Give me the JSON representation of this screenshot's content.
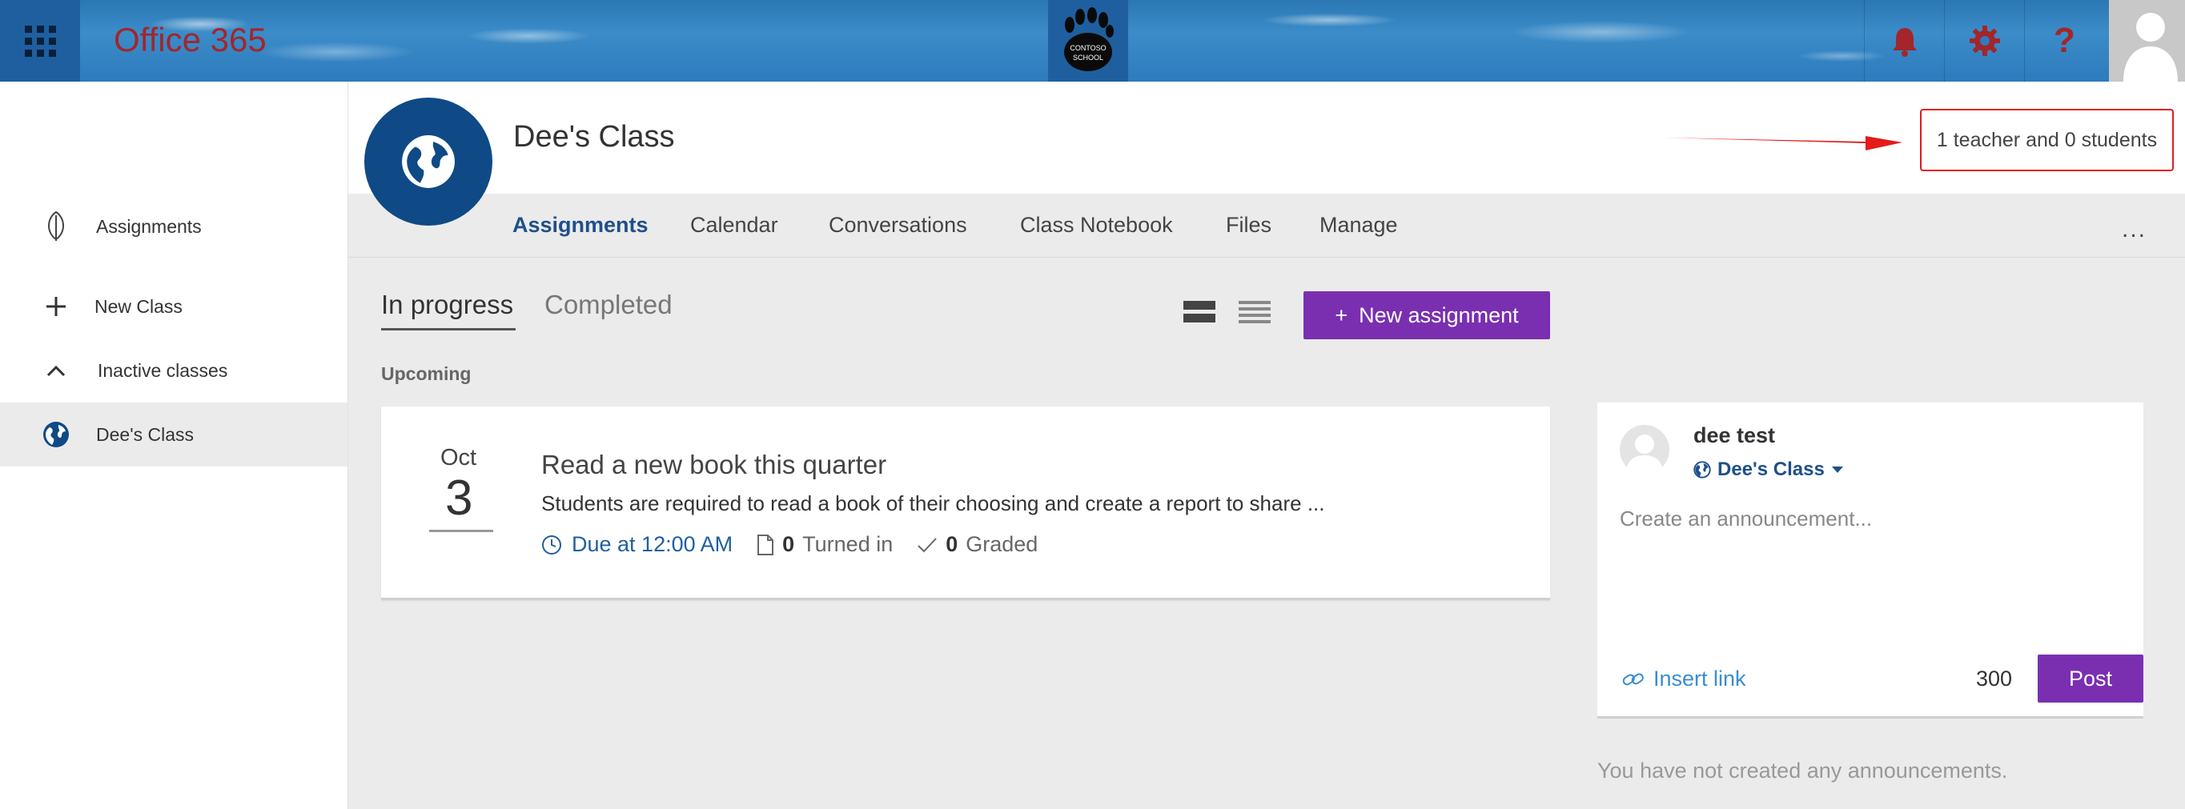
{
  "topbar": {
    "brand": "Office 365",
    "logo_text_line1": "CONTOSO",
    "logo_text_line2": "SCHOOL",
    "help_glyph": "?",
    "accent_color": "#a2262a",
    "bar_color": "#2d7bbd"
  },
  "sidebar": {
    "items": [
      {
        "label": "Assignments",
        "icon": "leaf-icon"
      },
      {
        "label": "New Class",
        "icon": "plus-icon"
      },
      {
        "label": "Inactive classes",
        "icon": "chevron-up-icon"
      },
      {
        "label": "Dee's Class",
        "icon": "globe-icon",
        "active": true
      }
    ]
  },
  "class": {
    "title": "Dee's Class",
    "members": "1 teacher and 0 students",
    "color": "#0f4a86"
  },
  "nav": {
    "tabs": [
      {
        "label": "Assignments",
        "active": true
      },
      {
        "label": "Calendar"
      },
      {
        "label": "Conversations"
      },
      {
        "label": "Class Notebook"
      },
      {
        "label": "Files"
      },
      {
        "label": "Manage"
      }
    ],
    "more": "..."
  },
  "assignments": {
    "subtabs": [
      {
        "label": "In progress",
        "active": true
      },
      {
        "label": "Completed"
      }
    ],
    "new_button_plus": "+",
    "new_button": "New assignment",
    "button_color": "#7a2fb0",
    "section": "Upcoming",
    "items": [
      {
        "month": "Oct",
        "day": "3",
        "title": "Read a new book this quarter",
        "description": "Students are required to read a book of their choosing and create a report to share ...",
        "due": "Due at 12:00 AM",
        "turned_in_count": "0",
        "turned_in_label": "Turned in",
        "graded_count": "0",
        "graded_label": "Graded"
      }
    ]
  },
  "announcement": {
    "user": "dee test",
    "class": "Dee's Class",
    "placeholder": "Create an announcement...",
    "insert_link": "Insert link",
    "char_count": "300",
    "post": "Post",
    "empty": "You have not created any announcements."
  }
}
